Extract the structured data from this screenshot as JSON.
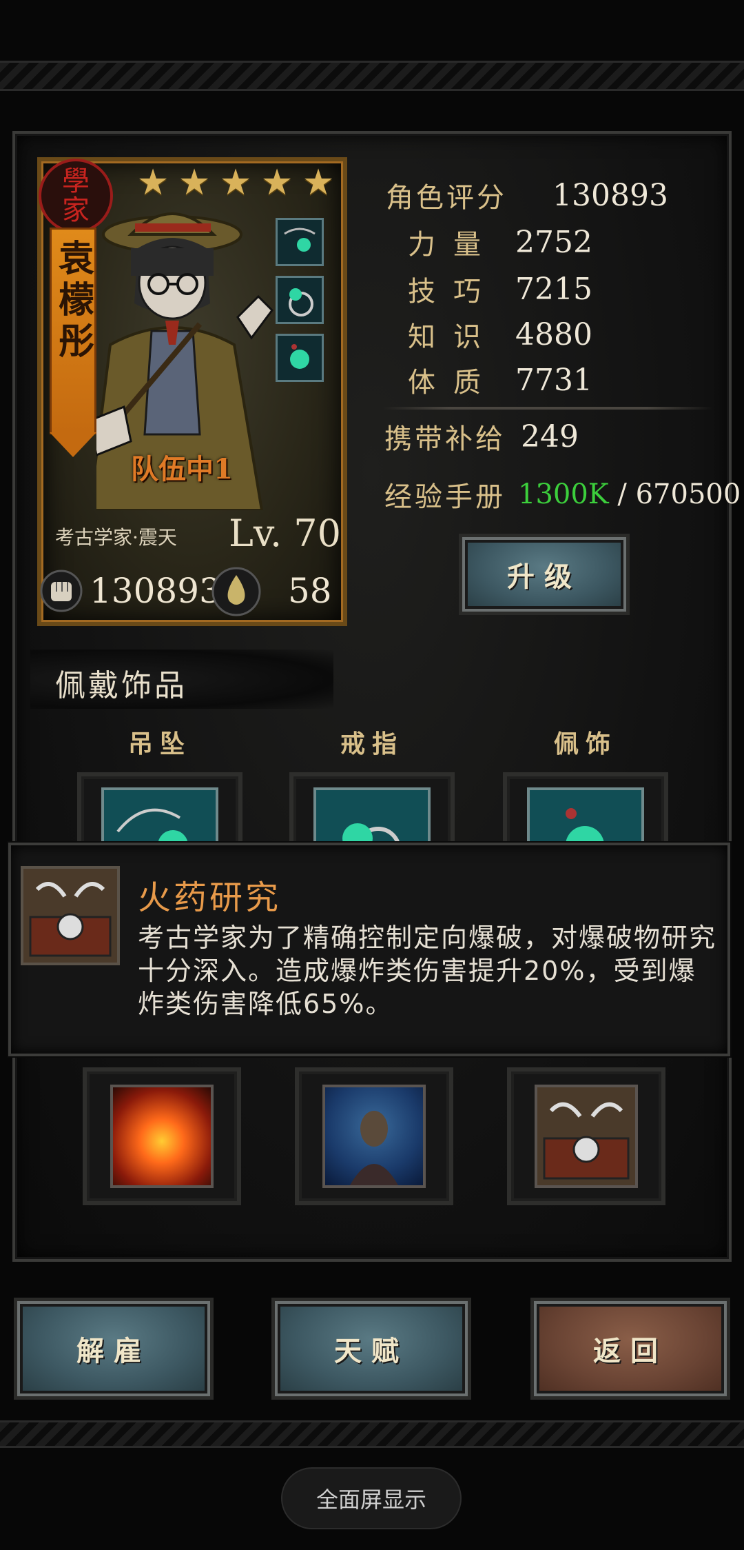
{
  "character": {
    "seal_line1": "學",
    "seal_line2": "家",
    "name": "袁檬彤",
    "stars": 5,
    "team_label": "队伍中1",
    "class_label": "考古学家·震天",
    "level": "Lv. 70",
    "power": "130893",
    "stamina": "58"
  },
  "stats": {
    "score_label": "角色评分",
    "score_value": "130893",
    "strength_label": "力量",
    "strength_value": "2752",
    "skill_label": "技巧",
    "skill_value": "7215",
    "knowledge_label": "知识",
    "knowledge_value": "4880",
    "constitution_label": "体质",
    "constitution_value": "7731",
    "supply_label": "携带补给",
    "supply_value": "249",
    "exp_label": "经验手册",
    "exp_current": "1300K",
    "exp_sep": " / ",
    "exp_required": "670500",
    "exp_color": "#3ccf3c"
  },
  "upgrade_button": "升级",
  "accessories": {
    "title": "佩戴饰品",
    "slots": [
      {
        "label": "吊坠",
        "icon": "pendant-icon"
      },
      {
        "label": "戒指",
        "icon": "ring-icon"
      },
      {
        "label": "佩饰",
        "icon": "charm-icon"
      }
    ]
  },
  "tooltip": {
    "title": "火药研究",
    "description": "考古学家为了精确控制定向爆破，对爆破物研究十分深入。造成爆炸类伤害提升20%，受到爆炸类伤害降低65%。",
    "icon": "explosives-icon"
  },
  "skills": [
    {
      "icon": "fire-explosion-icon"
    },
    {
      "icon": "scholar-study-icon"
    },
    {
      "icon": "explosives-icon"
    }
  ],
  "bottom_buttons": {
    "dismiss": "解雇",
    "talent": "天赋",
    "back": "返回"
  },
  "fullscreen_pill": "全面屏显示"
}
